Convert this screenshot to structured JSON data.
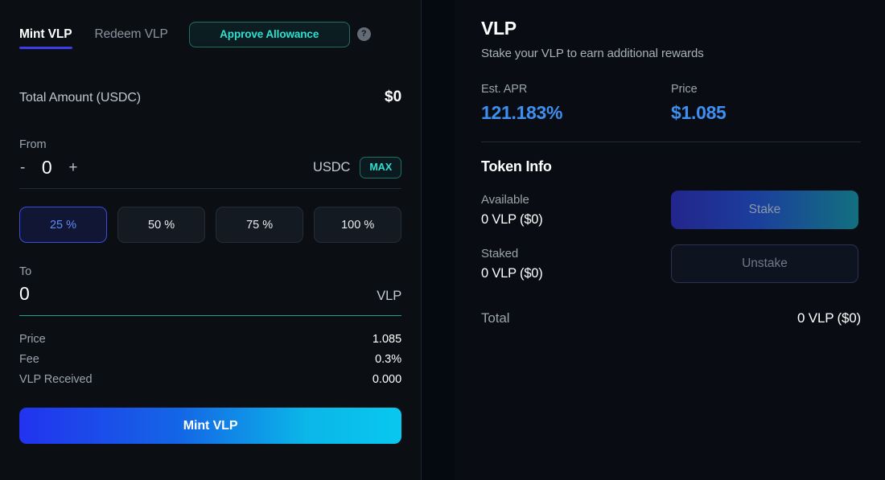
{
  "left": {
    "tabs": [
      {
        "label": "Mint VLP",
        "active": true
      },
      {
        "label": "Redeem VLP",
        "active": false
      }
    ],
    "approve_button": "Approve Allowance",
    "help_icon_glyph": "?",
    "total_amount": {
      "label": "Total Amount (USDC)",
      "value": "$0"
    },
    "from": {
      "label": "From",
      "decrement": "-",
      "increment": "+",
      "value": "0",
      "placeholder": "0",
      "token": "USDC",
      "max_label": "MAX"
    },
    "percent_buttons": [
      {
        "label": "25 %",
        "selected": true
      },
      {
        "label": "50 %",
        "selected": false
      },
      {
        "label": "75 %",
        "selected": false
      },
      {
        "label": "100 %",
        "selected": false
      }
    ],
    "to": {
      "label": "To",
      "value": "0",
      "token": "VLP"
    },
    "summary": [
      {
        "key": "Price",
        "value": "1.085"
      },
      {
        "key": "Fee",
        "value": "0.3%"
      },
      {
        "key": "VLP Received",
        "value": "0.000"
      }
    ],
    "submit_button": "Mint VLP"
  },
  "right": {
    "title": "VLP",
    "subtitle": "Stake your VLP to earn additional rewards",
    "stats": [
      {
        "label": "Est. APR",
        "value": "121.183%"
      },
      {
        "label": "Price",
        "value": "$1.085"
      }
    ],
    "token_info_title": "Token Info",
    "rows": [
      {
        "key": "Available",
        "value": "0 VLP ($0)",
        "action": "Stake"
      },
      {
        "key": "Staked",
        "value": "0 VLP ($0)",
        "action": "Unstake"
      }
    ],
    "total": {
      "key": "Total",
      "value": "0 VLP ($0)"
    }
  },
  "colors": {
    "accent_indigo": "#3d3ce8",
    "accent_teal": "#2fe0d0",
    "accent_blue": "#3d8ff0",
    "selected_pct_text": "#5b8cf5",
    "to_underline": "#1f9e94",
    "mint_gradient_start": "#2233ee",
    "mint_gradient_end": "#08c8ef"
  }
}
